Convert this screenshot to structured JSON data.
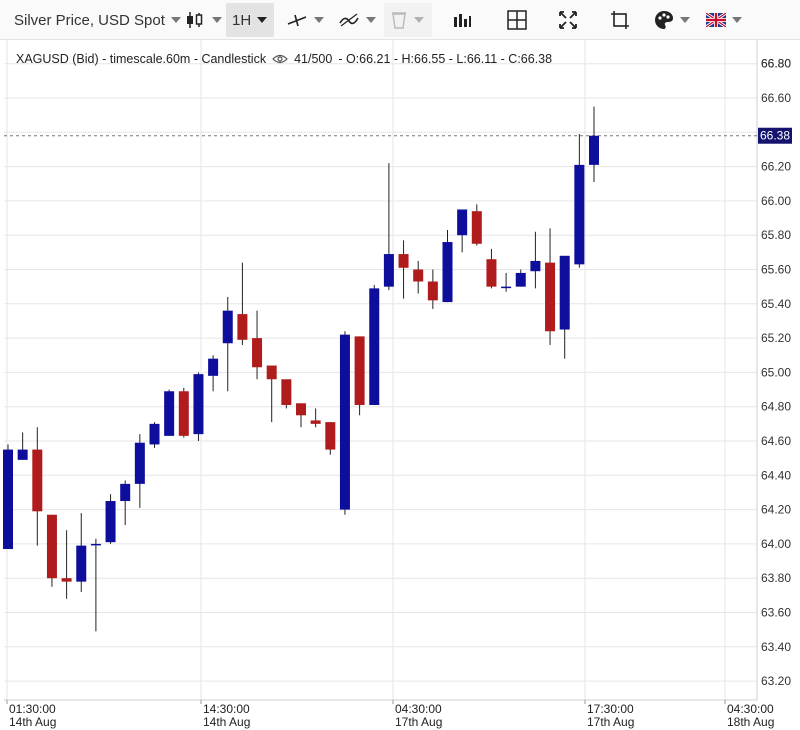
{
  "toolbar": {
    "symbol_label": "Silver Price, USD Spot",
    "interval_label": "1H",
    "chart_type_icon": "candlestick-icon",
    "line_tool_icon": "line-draw-icon",
    "indicator_icon": "indicator-icon",
    "delete_icon": "trash-icon",
    "volume_icon": "bars-icon",
    "crosshair_icon": "crosshair-icon",
    "fullscreen_icon": "fullscreen-icon",
    "screenshot_icon": "crop-icon",
    "theme_icon": "palette-icon",
    "language_icon": "uk-flag-icon"
  },
  "legend": {
    "symbol": "XAGUSD (Bid) - timescale.60m - Candlestick",
    "count": "41/500",
    "ohlc": "- O:66.21 - H:66.55 - L:66.11 - C:66.38"
  },
  "colors": {
    "up": "#0e0e9c",
    "down": "#b01c1c",
    "grid": "#e6e6e6",
    "last_price_bg": "#14146e"
  },
  "chart_data": {
    "type": "candlestick",
    "symbol": "XAGUSD",
    "last_price": "66.38",
    "ylim": [
      63.2,
      67.0
    ],
    "y_ticks": [
      "63.20",
      "63.40",
      "63.60",
      "63.80",
      "64.00",
      "64.20",
      "64.40",
      "64.60",
      "64.80",
      "65.00",
      "65.20",
      "65.40",
      "65.60",
      "65.80",
      "66.00",
      "66.20",
      "66.40",
      "66.60",
      "66.80"
    ],
    "x_ticks": [
      {
        "time": "01:30:00",
        "date": "14th Aug"
      },
      {
        "time": "14:30:00",
        "date": "14th Aug"
      },
      {
        "time": "04:30:00",
        "date": "17th Aug"
      },
      {
        "time": "17:30:00",
        "date": "17th Aug"
      },
      {
        "time": "04:30:00",
        "date": "18th Aug"
      }
    ],
    "candles": [
      {
        "o": 63.97,
        "h": 64.58,
        "l": 63.97,
        "c": 64.55
      },
      {
        "o": 64.49,
        "h": 64.65,
        "l": 64.49,
        "c": 64.55
      },
      {
        "o": 64.55,
        "h": 64.68,
        "l": 63.99,
        "c": 64.19
      },
      {
        "o": 64.17,
        "h": 64.17,
        "l": 63.75,
        "c": 63.8
      },
      {
        "o": 63.8,
        "h": 64.08,
        "l": 63.68,
        "c": 63.78
      },
      {
        "o": 63.78,
        "h": 64.18,
        "l": 63.72,
        "c": 63.99
      },
      {
        "o": 64.0,
        "h": 64.03,
        "l": 63.49,
        "c": 64.0
      },
      {
        "o": 64.01,
        "h": 64.29,
        "l": 64.0,
        "c": 64.25
      },
      {
        "o": 64.25,
        "h": 64.37,
        "l": 64.11,
        "c": 64.35
      },
      {
        "o": 64.35,
        "h": 64.64,
        "l": 64.21,
        "c": 64.59
      },
      {
        "o": 64.58,
        "h": 64.71,
        "l": 64.56,
        "c": 64.7
      },
      {
        "o": 64.63,
        "h": 64.9,
        "l": 64.63,
        "c": 64.89
      },
      {
        "o": 64.89,
        "h": 64.91,
        "l": 64.62,
        "c": 64.63
      },
      {
        "o": 64.64,
        "h": 65.0,
        "l": 64.6,
        "c": 64.99
      },
      {
        "o": 64.98,
        "h": 65.1,
        "l": 64.89,
        "c": 65.08
      },
      {
        "o": 65.17,
        "h": 65.44,
        "l": 64.89,
        "c": 65.36
      },
      {
        "o": 65.34,
        "h": 65.64,
        "l": 65.16,
        "c": 65.19
      },
      {
        "o": 65.2,
        "h": 65.36,
        "l": 64.96,
        "c": 65.03
      },
      {
        "o": 65.04,
        "h": 65.04,
        "l": 64.71,
        "c": 64.96
      },
      {
        "o": 64.96,
        "h": 64.95,
        "l": 64.79,
        "c": 64.81
      },
      {
        "o": 64.82,
        "h": 64.82,
        "l": 64.68,
        "c": 64.75
      },
      {
        "o": 64.72,
        "h": 64.79,
        "l": 64.68,
        "c": 64.7
      },
      {
        "o": 64.71,
        "h": 64.71,
        "l": 64.52,
        "c": 64.55
      },
      {
        "o": 64.2,
        "h": 65.24,
        "l": 64.17,
        "c": 65.22
      },
      {
        "o": 65.21,
        "h": 65.21,
        "l": 64.75,
        "c": 64.81
      },
      {
        "o": 64.81,
        "h": 65.51,
        "l": 64.81,
        "c": 65.49
      },
      {
        "o": 65.5,
        "h": 66.22,
        "l": 65.48,
        "c": 65.69
      },
      {
        "o": 65.69,
        "h": 65.77,
        "l": 65.43,
        "c": 65.61
      },
      {
        "o": 65.6,
        "h": 65.65,
        "l": 65.46,
        "c": 65.53
      },
      {
        "o": 65.53,
        "h": 65.6,
        "l": 65.37,
        "c": 65.42
      },
      {
        "o": 65.41,
        "h": 65.83,
        "l": 65.41,
        "c": 65.76
      },
      {
        "o": 65.8,
        "h": 65.95,
        "l": 65.7,
        "c": 65.95
      },
      {
        "o": 65.94,
        "h": 65.98,
        "l": 65.74,
        "c": 65.75
      },
      {
        "o": 65.66,
        "h": 65.72,
        "l": 65.49,
        "c": 65.5
      },
      {
        "o": 65.5,
        "h": 65.58,
        "l": 65.47,
        "c": 65.5
      },
      {
        "o": 65.5,
        "h": 65.6,
        "l": 65.5,
        "c": 65.58
      },
      {
        "o": 65.59,
        "h": 65.82,
        "l": 65.49,
        "c": 65.65
      },
      {
        "o": 65.64,
        "h": 65.84,
        "l": 65.16,
        "c": 65.24
      },
      {
        "o": 65.25,
        "h": 65.67,
        "l": 65.08,
        "c": 65.68
      },
      {
        "o": 65.63,
        "h": 66.39,
        "l": 65.61,
        "c": 66.21
      },
      {
        "o": 66.21,
        "h": 66.55,
        "l": 66.11,
        "c": 66.38
      }
    ]
  }
}
